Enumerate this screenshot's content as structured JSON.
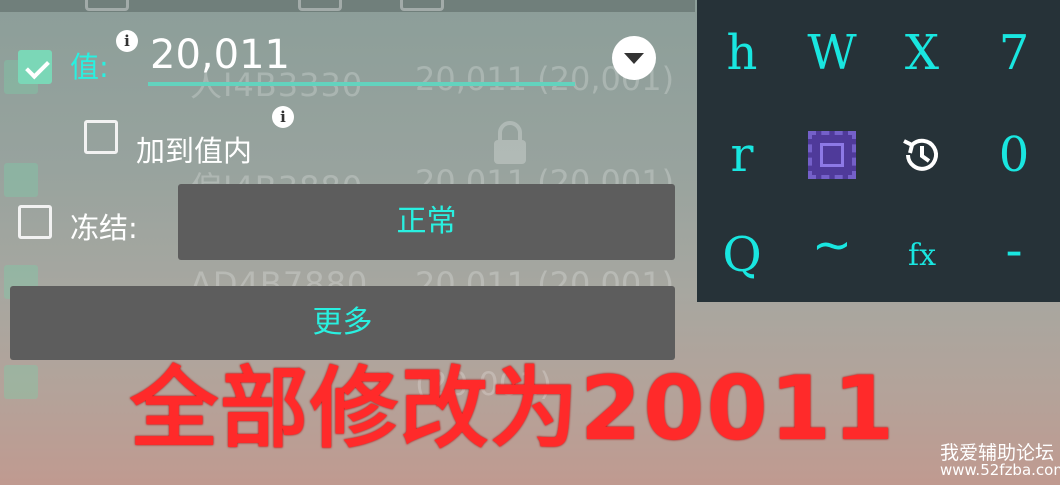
{
  "background_list": {
    "rows": [
      {
        "address": "人I4B3330",
        "value": "20,011 (20,001)"
      },
      {
        "address": "偏I4B3880",
        "value": "20,011 (20,001)"
      },
      {
        "address": "AD4B7880",
        "value": "20,011 (20,001)"
      },
      {
        "address": "",
        "value": "(20,001)"
      }
    ]
  },
  "dialog": {
    "value_label": "值:",
    "value_input": "20,011",
    "add_to_value_label": "加到值内",
    "freeze_label": "冻结:",
    "freeze_mode": "正常",
    "more_button": "更多"
  },
  "keypad": {
    "keys": [
      "h",
      "W",
      "X",
      "7",
      "r",
      "select-icon",
      "history-icon",
      "0",
      "Q",
      "~",
      "fx",
      "-"
    ]
  },
  "overlay": {
    "banner": "全部修改为20011",
    "watermark_line1": "我爱辅助论坛",
    "watermark_line2": "www.52fzba.com"
  },
  "colors": {
    "accent_cyan": "#29f0e0",
    "checkbox_green": "#7bd7b7",
    "banner_red": "#ff2a2a",
    "keypad_bg": "#263238"
  }
}
